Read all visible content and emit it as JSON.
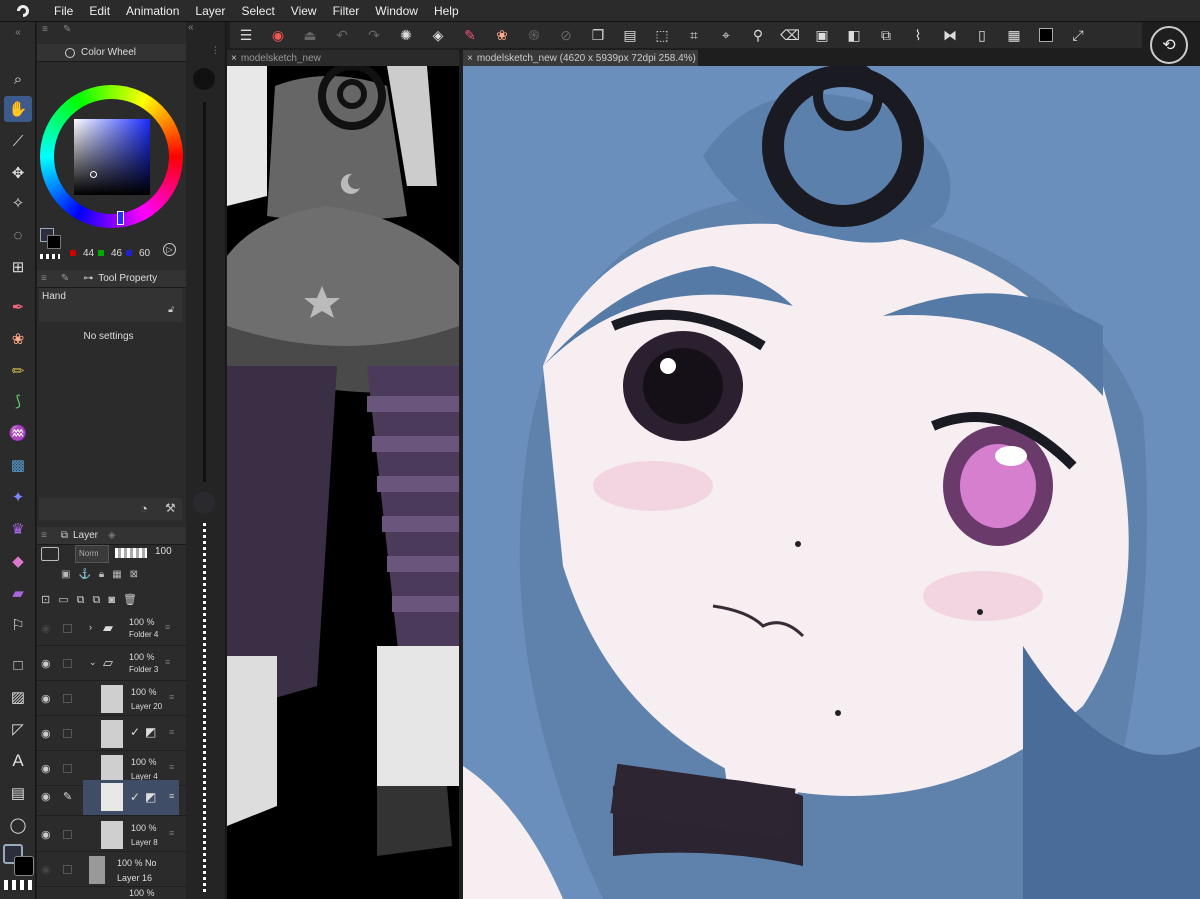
{
  "menu": {
    "items": [
      "File",
      "Edit",
      "Animation",
      "Layer",
      "Select",
      "View",
      "Filter",
      "Window",
      "Help"
    ]
  },
  "tabs": {
    "left": "modelsketch_new",
    "right": "modelsketch_new (4620 x 5939px 72dpi 258.4%)"
  },
  "color_wheel": {
    "title": "Color Wheel",
    "r": "44",
    "g": "46",
    "b": "60",
    "current_color": "#2c2e3c"
  },
  "tool_property": {
    "title": "Tool Property",
    "tool_name": "Hand",
    "message": "No settings"
  },
  "layer_panel": {
    "title": "Layer",
    "blend_mode": "Norm",
    "opacity": "100",
    "layers": [
      {
        "opacity": "100 %",
        "name": "Folder 4",
        "type": "folder",
        "visible": false
      },
      {
        "opacity": "100 %",
        "name": "Folder 3",
        "type": "folder",
        "visible": true
      },
      {
        "opacity": "100 %",
        "name": "Layer 20",
        "type": "layer",
        "visible": true
      },
      {
        "opacity": "",
        "name": "",
        "type": "checked",
        "visible": true
      },
      {
        "opacity": "100 %",
        "name": "Layer 4",
        "type": "layer",
        "visible": true
      },
      {
        "opacity": "",
        "name": "",
        "type": "checked-selected",
        "visible": true
      },
      {
        "opacity": "100 %",
        "name": "Layer 8",
        "type": "layer",
        "visible": true
      },
      {
        "opacity": "100 % No",
        "name": "Layer 16",
        "type": "layer",
        "visible": false
      },
      {
        "opacity": "100 %",
        "name": "",
        "type": "layer",
        "visible": false
      }
    ]
  },
  "colors": {
    "accent": "#3c5a8a",
    "panel_bg": "#2b2b2b",
    "hair": "#6b8fb9",
    "skin": "#f4ecef"
  }
}
